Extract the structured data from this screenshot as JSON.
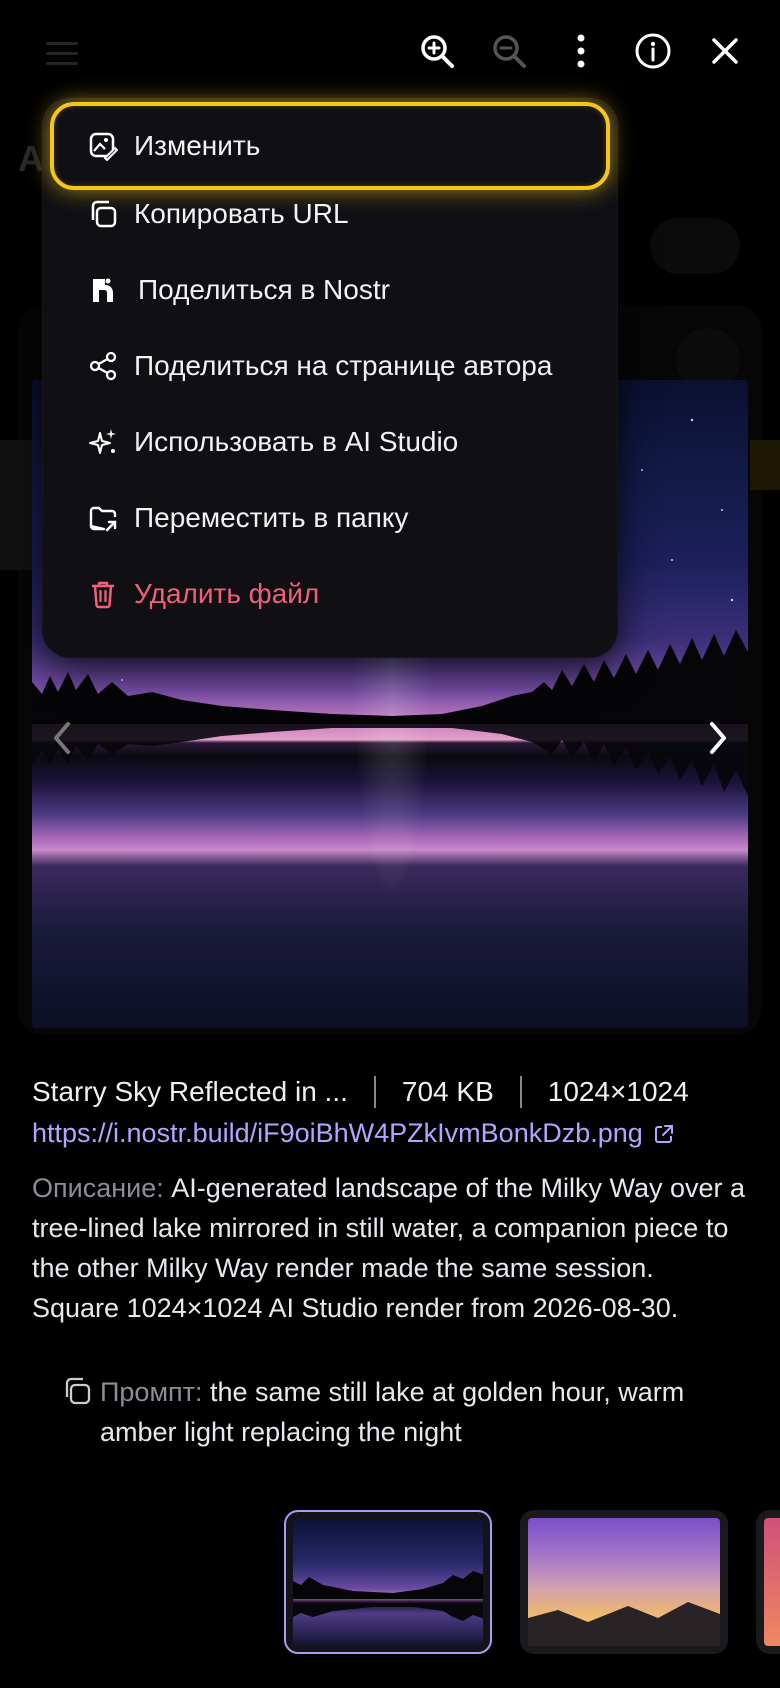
{
  "toolbar": {
    "buttons": [
      {
        "icon": "zoom-in-icon"
      },
      {
        "icon": "zoom-out-icon"
      },
      {
        "icon": "more-vertical-icon"
      },
      {
        "icon": "info-icon"
      },
      {
        "icon": "close-icon"
      }
    ]
  },
  "menu": {
    "items": [
      {
        "label": "Изменить",
        "icon": "edit-image-icon"
      },
      {
        "label": "Копировать URL",
        "icon": "copy-icon"
      },
      {
        "label": "Поделиться в Nostr",
        "icon": "nostr-icon"
      },
      {
        "label": "Поделиться на странице автора",
        "icon": "share-icon"
      },
      {
        "label": "Использовать в AI Studio",
        "icon": "sparkles-icon"
      },
      {
        "label": "Переместить в папку",
        "icon": "folder-move-icon"
      },
      {
        "label": "Удалить файл",
        "icon": "trash-icon"
      }
    ],
    "danger_color": "#f0607a",
    "focus_color": "#f5c518"
  },
  "file": {
    "title": "Starry Sky Reflected in ...",
    "size": "704 KB",
    "dimensions": "1024×1024",
    "url": "https://i.nostr.build/iF9oiBhW4PZkIvmBonkDzb.png"
  },
  "description": {
    "label": "Описание:",
    "text": " AI-generated landscape of the Milky Way over a tree-lined lake mirrored in still water, a companion piece to the other Milky Way render made the same session. Square 1024×1024 AI Studio render from 2026-08-30."
  },
  "prompt": {
    "label": "Промпт:",
    "text": " the same still lake at golden hour, warm amber light replacing the night"
  },
  "colors": {
    "link": "#b4a4ff",
    "active_thumb_border": "#a89cf5"
  }
}
